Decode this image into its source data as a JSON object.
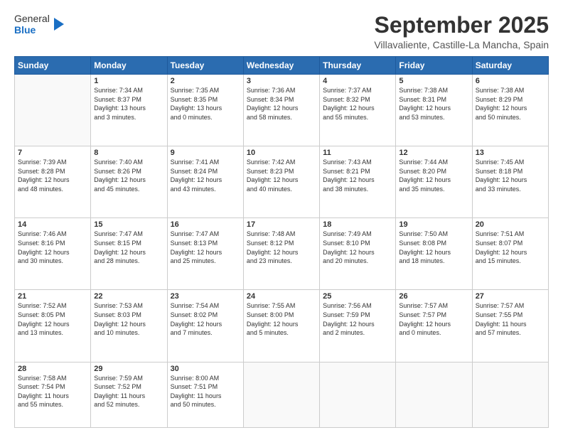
{
  "header": {
    "logo_line1": "General",
    "logo_line2": "Blue",
    "month": "September 2025",
    "location": "Villavaliente, Castille-La Mancha, Spain"
  },
  "weekdays": [
    "Sunday",
    "Monday",
    "Tuesday",
    "Wednesday",
    "Thursday",
    "Friday",
    "Saturday"
  ],
  "weeks": [
    [
      {
        "day": "",
        "info": ""
      },
      {
        "day": "1",
        "info": "Sunrise: 7:34 AM\nSunset: 8:37 PM\nDaylight: 13 hours\nand 3 minutes."
      },
      {
        "day": "2",
        "info": "Sunrise: 7:35 AM\nSunset: 8:35 PM\nDaylight: 13 hours\nand 0 minutes."
      },
      {
        "day": "3",
        "info": "Sunrise: 7:36 AM\nSunset: 8:34 PM\nDaylight: 12 hours\nand 58 minutes."
      },
      {
        "day": "4",
        "info": "Sunrise: 7:37 AM\nSunset: 8:32 PM\nDaylight: 12 hours\nand 55 minutes."
      },
      {
        "day": "5",
        "info": "Sunrise: 7:38 AM\nSunset: 8:31 PM\nDaylight: 12 hours\nand 53 minutes."
      },
      {
        "day": "6",
        "info": "Sunrise: 7:38 AM\nSunset: 8:29 PM\nDaylight: 12 hours\nand 50 minutes."
      }
    ],
    [
      {
        "day": "7",
        "info": "Sunrise: 7:39 AM\nSunset: 8:28 PM\nDaylight: 12 hours\nand 48 minutes."
      },
      {
        "day": "8",
        "info": "Sunrise: 7:40 AM\nSunset: 8:26 PM\nDaylight: 12 hours\nand 45 minutes."
      },
      {
        "day": "9",
        "info": "Sunrise: 7:41 AM\nSunset: 8:24 PM\nDaylight: 12 hours\nand 43 minutes."
      },
      {
        "day": "10",
        "info": "Sunrise: 7:42 AM\nSunset: 8:23 PM\nDaylight: 12 hours\nand 40 minutes."
      },
      {
        "day": "11",
        "info": "Sunrise: 7:43 AM\nSunset: 8:21 PM\nDaylight: 12 hours\nand 38 minutes."
      },
      {
        "day": "12",
        "info": "Sunrise: 7:44 AM\nSunset: 8:20 PM\nDaylight: 12 hours\nand 35 minutes."
      },
      {
        "day": "13",
        "info": "Sunrise: 7:45 AM\nSunset: 8:18 PM\nDaylight: 12 hours\nand 33 minutes."
      }
    ],
    [
      {
        "day": "14",
        "info": "Sunrise: 7:46 AM\nSunset: 8:16 PM\nDaylight: 12 hours\nand 30 minutes."
      },
      {
        "day": "15",
        "info": "Sunrise: 7:47 AM\nSunset: 8:15 PM\nDaylight: 12 hours\nand 28 minutes."
      },
      {
        "day": "16",
        "info": "Sunrise: 7:47 AM\nSunset: 8:13 PM\nDaylight: 12 hours\nand 25 minutes."
      },
      {
        "day": "17",
        "info": "Sunrise: 7:48 AM\nSunset: 8:12 PM\nDaylight: 12 hours\nand 23 minutes."
      },
      {
        "day": "18",
        "info": "Sunrise: 7:49 AM\nSunset: 8:10 PM\nDaylight: 12 hours\nand 20 minutes."
      },
      {
        "day": "19",
        "info": "Sunrise: 7:50 AM\nSunset: 8:08 PM\nDaylight: 12 hours\nand 18 minutes."
      },
      {
        "day": "20",
        "info": "Sunrise: 7:51 AM\nSunset: 8:07 PM\nDaylight: 12 hours\nand 15 minutes."
      }
    ],
    [
      {
        "day": "21",
        "info": "Sunrise: 7:52 AM\nSunset: 8:05 PM\nDaylight: 12 hours\nand 13 minutes."
      },
      {
        "day": "22",
        "info": "Sunrise: 7:53 AM\nSunset: 8:03 PM\nDaylight: 12 hours\nand 10 minutes."
      },
      {
        "day": "23",
        "info": "Sunrise: 7:54 AM\nSunset: 8:02 PM\nDaylight: 12 hours\nand 7 minutes."
      },
      {
        "day": "24",
        "info": "Sunrise: 7:55 AM\nSunset: 8:00 PM\nDaylight: 12 hours\nand 5 minutes."
      },
      {
        "day": "25",
        "info": "Sunrise: 7:56 AM\nSunset: 7:59 PM\nDaylight: 12 hours\nand 2 minutes."
      },
      {
        "day": "26",
        "info": "Sunrise: 7:57 AM\nSunset: 7:57 PM\nDaylight: 12 hours\nand 0 minutes."
      },
      {
        "day": "27",
        "info": "Sunrise: 7:57 AM\nSunset: 7:55 PM\nDaylight: 11 hours\nand 57 minutes."
      }
    ],
    [
      {
        "day": "28",
        "info": "Sunrise: 7:58 AM\nSunset: 7:54 PM\nDaylight: 11 hours\nand 55 minutes."
      },
      {
        "day": "29",
        "info": "Sunrise: 7:59 AM\nSunset: 7:52 PM\nDaylight: 11 hours\nand 52 minutes."
      },
      {
        "day": "30",
        "info": "Sunrise: 8:00 AM\nSunset: 7:51 PM\nDaylight: 11 hours\nand 50 minutes."
      },
      {
        "day": "",
        "info": ""
      },
      {
        "day": "",
        "info": ""
      },
      {
        "day": "",
        "info": ""
      },
      {
        "day": "",
        "info": ""
      }
    ]
  ]
}
